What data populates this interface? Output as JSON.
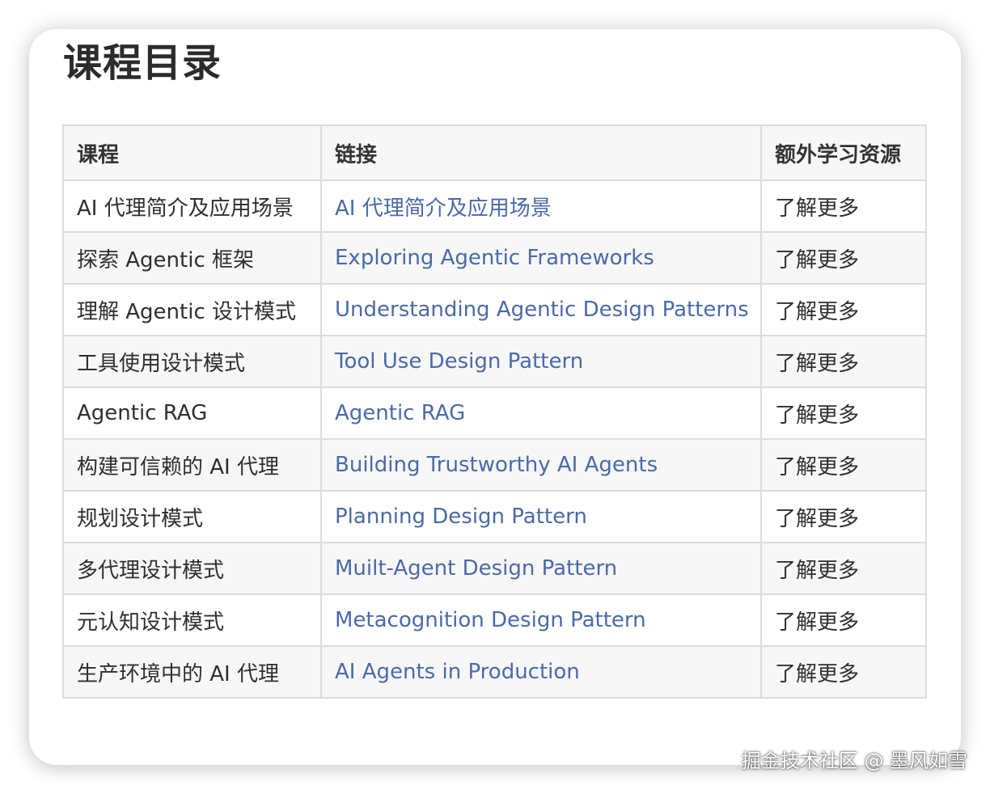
{
  "page": {
    "title": "课程目录"
  },
  "table": {
    "headers": [
      "课程",
      "链接",
      "额外学习资源"
    ],
    "rows": [
      {
        "course": "AI 代理简介及应用场景",
        "link": "AI 代理简介及应用场景",
        "extra": "了解更多"
      },
      {
        "course": "探索 Agentic 框架",
        "link": "Exploring Agentic Frameworks",
        "extra": "了解更多"
      },
      {
        "course": "理解 Agentic 设计模式",
        "link": "Understanding Agentic Design Patterns",
        "extra": "了解更多"
      },
      {
        "course": "工具使用设计模式",
        "link": "Tool Use Design Pattern",
        "extra": "了解更多"
      },
      {
        "course": "Agentic RAG",
        "link": "Agentic RAG",
        "extra": "了解更多"
      },
      {
        "course": "构建可信赖的 AI 代理",
        "link": "Building Trustworthy AI Agents",
        "extra": "了解更多"
      },
      {
        "course": "规划设计模式",
        "link": "Planning Design Pattern",
        "extra": "了解更多"
      },
      {
        "course": "多代理设计模式",
        "link": "Muilt-Agent Design Pattern",
        "extra": "了解更多"
      },
      {
        "course": "元认知设计模式",
        "link": "Metacognition Design Pattern",
        "extra": "了解更多"
      },
      {
        "course": "生产环境中的 AI 代理",
        "link": "AI Agents in Production",
        "extra": "了解更多"
      }
    ]
  },
  "watermark": "掘金技术社区 @ 墨风如雪",
  "colors": {
    "link": "#4a6aa8",
    "text": "#2f2f2f",
    "border": "#dcdcdc",
    "stripe": "#f7f7f7"
  }
}
